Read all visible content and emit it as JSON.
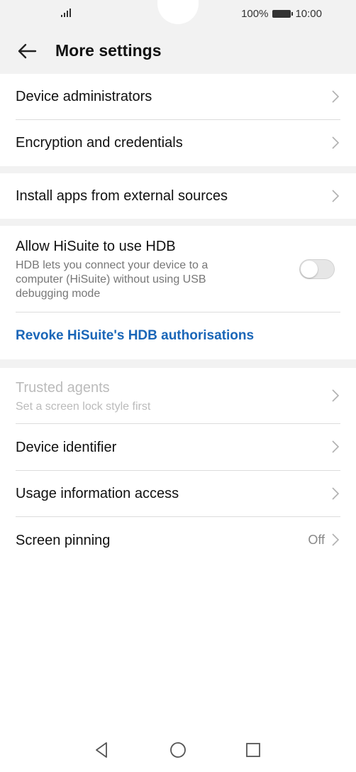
{
  "status_bar": {
    "battery_text": "100%",
    "time": "10:00"
  },
  "header": {
    "title": "More settings",
    "back_icon": "arrow-left-icon"
  },
  "groups": {
    "g1": [
      {
        "label": "Device administrators"
      },
      {
        "label": "Encryption and credentials"
      }
    ],
    "g2": [
      {
        "label": "Install apps from external sources"
      }
    ],
    "g3": {
      "hdb_title": "Allow HiSuite to use HDB",
      "hdb_desc_1": "HDB lets you connect your device to a",
      "hdb_desc_2": "computer (HiSuite) without using USB",
      "hdb_desc_3": "debugging mode",
      "hdb_toggle": "off",
      "revoke_label": "Revoke HiSuite's HDB authorisations"
    },
    "g4": {
      "trusted_title": "Trusted agents",
      "trusted_sub": "Set a screen lock style first",
      "device_identifier": "Device identifier",
      "usage_access": "Usage information access",
      "screen_pinning": "Screen pinning",
      "screen_pinning_value": "Off"
    }
  },
  "colors": {
    "accent_link": "#1a66b8",
    "background": "#f2f2f2",
    "card": "#ffffff"
  },
  "nav": {
    "back_icon": "triangle-back-icon",
    "home_icon": "circle-home-icon",
    "recents_icon": "square-recents-icon"
  }
}
